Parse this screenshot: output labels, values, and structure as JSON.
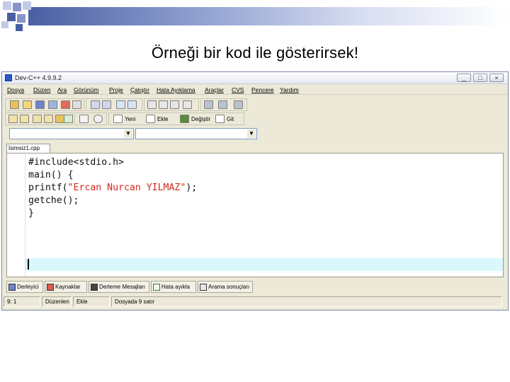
{
  "slide": {
    "title": "Örneği bir kod ile gösterirsek!"
  },
  "window": {
    "title": "Dev-C++ 4.9.9.2",
    "controls": {
      "minimize": "_",
      "maximize": "□",
      "close": "×"
    }
  },
  "menu": [
    "Dosya",
    "Düzen",
    "Ara",
    "Görünüm",
    "Proje",
    "Çalıştır",
    "Hata Ayıklama",
    "Araçlar",
    "CVS",
    "Pencere",
    "Yardım"
  ],
  "toolbar": {
    "new_label": "Yeni",
    "insert_label": "Ekle",
    "toggle_label": "Değiştir",
    "goto_label": "Git"
  },
  "combos": {
    "class_value": "",
    "function_value": ""
  },
  "editor": {
    "tab_label": "İsimsiz1.cpp",
    "lines": [
      {
        "plain": "#include<stdio.h>"
      },
      {
        "plain": ""
      },
      {
        "plain": "main() {"
      },
      {
        "plain": ""
      },
      {
        "plain": "printf(",
        "str": "\"Ercan Nurcan YILMAZ\"",
        "rest": ");"
      },
      {
        "plain": ""
      },
      {
        "plain": "getche();"
      },
      {
        "plain": "}"
      }
    ]
  },
  "bottom_tabs": [
    "Derleyici",
    "Kaynaklar",
    "Derleme Mesajları",
    "Hata ayıkla",
    "Arama sonuçları"
  ],
  "status": {
    "position": "9: 1",
    "mode": "Düzenlen",
    "insert": "Ekle",
    "lines": "Dosyada 9 satır"
  },
  "colors": {
    "accent": "#4a5fa3",
    "current_line": "#d9f7fd",
    "string": "#d12a1f"
  }
}
